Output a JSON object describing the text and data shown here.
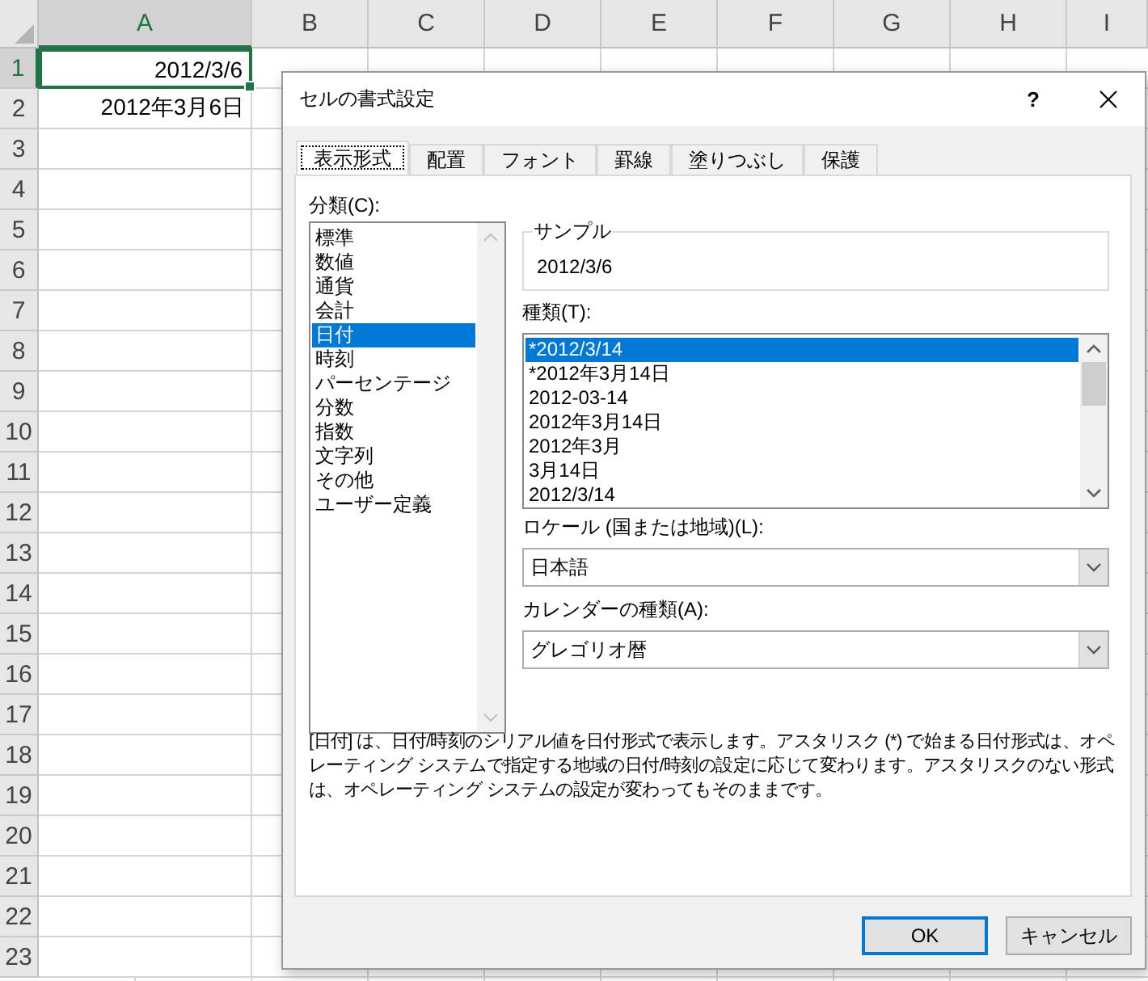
{
  "sheet": {
    "columns": [
      {
        "label": "A",
        "selected": true
      },
      {
        "label": "B",
        "selected": false
      },
      {
        "label": "C",
        "selected": false
      },
      {
        "label": "D",
        "selected": false
      },
      {
        "label": "E",
        "selected": false
      },
      {
        "label": "F",
        "selected": false
      },
      {
        "label": "G",
        "selected": false
      },
      {
        "label": "H",
        "selected": false
      },
      {
        "label": "I",
        "selected": false
      }
    ],
    "rows": [
      {
        "label": "1",
        "selected": true,
        "cells": [
          "2012/3/6"
        ]
      },
      {
        "label": "2",
        "selected": false,
        "cells": [
          "2012年3月6日"
        ]
      },
      {
        "label": "3",
        "selected": false
      },
      {
        "label": "4",
        "selected": false
      },
      {
        "label": "5",
        "selected": false
      },
      {
        "label": "6",
        "selected": false
      },
      {
        "label": "7",
        "selected": false
      },
      {
        "label": "8",
        "selected": false
      },
      {
        "label": "9",
        "selected": false
      },
      {
        "label": "10",
        "selected": false
      },
      {
        "label": "11",
        "selected": false
      },
      {
        "label": "12",
        "selected": false
      },
      {
        "label": "13",
        "selected": false
      },
      {
        "label": "14",
        "selected": false
      },
      {
        "label": "15",
        "selected": false
      },
      {
        "label": "16",
        "selected": false
      },
      {
        "label": "17",
        "selected": false
      },
      {
        "label": "18",
        "selected": false
      },
      {
        "label": "19",
        "selected": false
      },
      {
        "label": "20",
        "selected": false
      },
      {
        "label": "21",
        "selected": false
      },
      {
        "label": "22",
        "selected": false
      },
      {
        "label": "23",
        "selected": false
      }
    ]
  },
  "dialog": {
    "title": "セルの書式設定",
    "help_button": "?",
    "tabs": [
      {
        "label": "表示形式",
        "selected": true
      },
      {
        "label": "配置",
        "selected": false
      },
      {
        "label": "フォント",
        "selected": false
      },
      {
        "label": "罫線",
        "selected": false
      },
      {
        "label": "塗りつぶし",
        "selected": false
      },
      {
        "label": "保護",
        "selected": false
      }
    ],
    "category": {
      "label": "分類(C):",
      "items": [
        {
          "label": "標準",
          "selected": false
        },
        {
          "label": "数値",
          "selected": false
        },
        {
          "label": "通貨",
          "selected": false
        },
        {
          "label": "会計",
          "selected": false
        },
        {
          "label": "日付",
          "selected": true
        },
        {
          "label": "時刻",
          "selected": false
        },
        {
          "label": "パーセンテージ",
          "selected": false
        },
        {
          "label": "分数",
          "selected": false
        },
        {
          "label": "指数",
          "selected": false
        },
        {
          "label": "文字列",
          "selected": false
        },
        {
          "label": "その他",
          "selected": false
        },
        {
          "label": "ユーザー定義",
          "selected": false
        }
      ]
    },
    "sample": {
      "label": "サンプル",
      "value": "2012/3/6"
    },
    "type": {
      "label": "種類(T):",
      "items": [
        {
          "label": "*2012/3/14",
          "selected": true
        },
        {
          "label": "*2012年3月14日",
          "selected": false
        },
        {
          "label": "2012-03-14",
          "selected": false
        },
        {
          "label": "2012年3月14日",
          "selected": false
        },
        {
          "label": "2012年3月",
          "selected": false
        },
        {
          "label": "3月14日",
          "selected": false
        },
        {
          "label": "2012/3/14",
          "selected": false
        }
      ]
    },
    "locale": {
      "label": "ロケール (国または地域)(L):",
      "value": "日本語"
    },
    "calendar": {
      "label": "カレンダーの種類(A):",
      "value": "グレゴリオ暦"
    },
    "description": "[日付] は、日付/時刻のシリアル値を日付形式で表示します。アスタリスク (*) で始まる日付形式は、オペレーティング システムで指定する地域の日付/時刻の設定に応じて変わります。アスタリスクのない形式は、オペレーティング システムの設定が変わってもそのままです。",
    "buttons": [
      {
        "label": "OK",
        "default": true
      },
      {
        "label": "キャンセル",
        "default": false
      }
    ]
  }
}
